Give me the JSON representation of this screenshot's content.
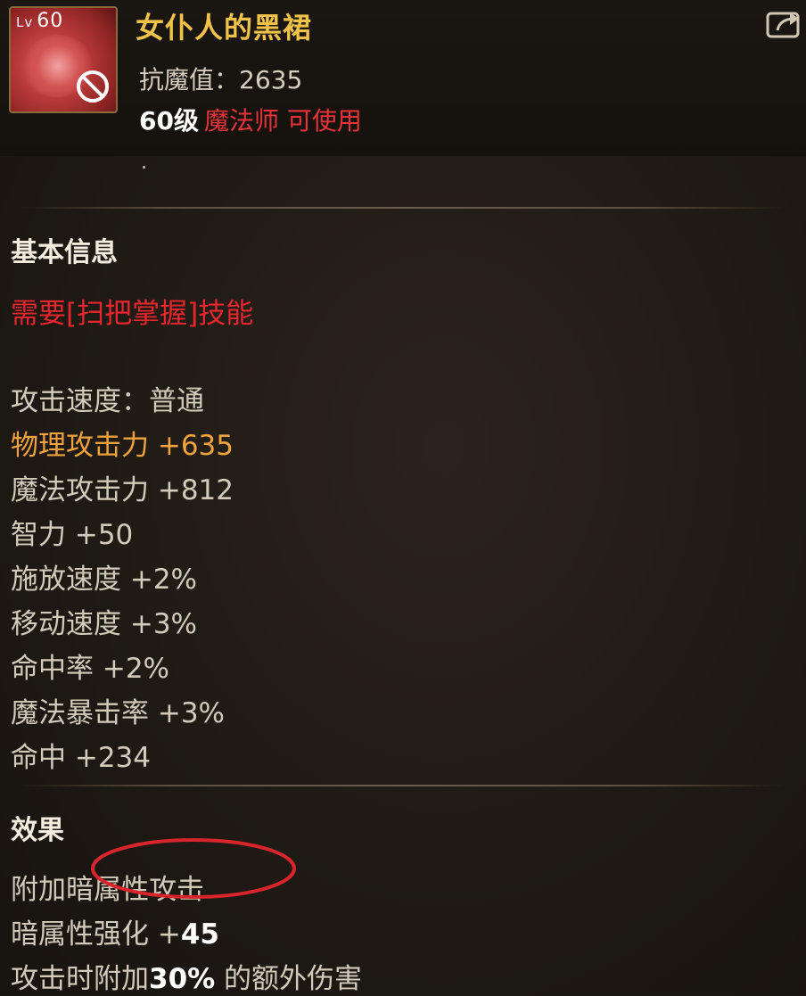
{
  "item": {
    "level_prefix": "Lv",
    "level": "60",
    "name": "女仆人的黑裙",
    "resist_label": "抗魔值：",
    "resist_value": "2635",
    "required_level": "60级",
    "class_text": "魔法师 可使用"
  },
  "basic": {
    "title": "基本信息",
    "requirement": "需要[扫把掌握]技能",
    "stats": [
      "攻击速度：普通",
      "物理攻击力 +635",
      "魔法攻击力 +812",
      "智力 +50",
      "施放速度 +2%",
      "移动速度 +3%",
      "命中率 +2%",
      "魔法暴击率 +3%",
      "命中 +234"
    ]
  },
  "effect": {
    "title": "效果",
    "line1": "附加暗属性攻击",
    "line2_label": "暗属性强化 +",
    "line2_value": "45",
    "line3_prefix": "攻击时附加",
    "line3_value": "30%",
    "line3_suffix": " 的额外伤害"
  },
  "colors": {
    "name": "#f0c24a",
    "class": "#e6333a",
    "requirement": "#e8262e",
    "highlight_stat": "#f0a23c",
    "annotation_circle": "#d8252c"
  },
  "icons": {
    "item_icon": "maid-dress-icon",
    "unusable": "no-entry-icon",
    "share": "share-icon"
  }
}
